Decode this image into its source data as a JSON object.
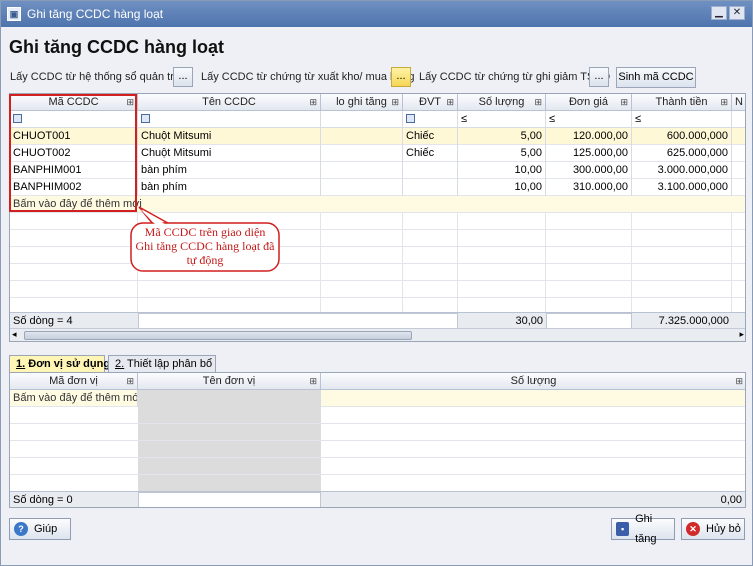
{
  "window": {
    "title": "Ghi tăng CCDC hàng loạt",
    "minimize": "▁",
    "close": "✕"
  },
  "heading": "Ghi tăng CCDC hàng loạt",
  "toolbar": {
    "label1": "Lấy CCDC từ hệ thống sổ quản trị",
    "label2": "Lấy CCDC từ chứng từ xuất kho/ mua hàng",
    "label3": "Lấy CCDC từ chứng từ ghi giảm TSCĐ",
    "dots": "...",
    "sinh_ma": "Sinh mã CCDC"
  },
  "main_grid": {
    "columns": [
      "Mã CCDC",
      "Tên CCDC",
      "lo ghi tăng",
      "ĐVT",
      "Số lượng",
      "Đơn giá",
      "Thành tiền",
      "N"
    ],
    "filter_ops": {
      "soluong": "≤",
      "dongia": "≤",
      "thanhtien": "≤"
    },
    "rows": [
      {
        "ma": "CHUOT001",
        "ten": "Chuột Mitsumi",
        "dvt": "Chiếc",
        "soluong": "5,00",
        "dongia": "120.000,00",
        "thanhtien": "600.000,000"
      },
      {
        "ma": "CHUOT002",
        "ten": "Chuột Mitsumi",
        "dvt": "Chiếc",
        "soluong": "5,00",
        "dongia": "125.000,00",
        "thanhtien": "625.000,000"
      },
      {
        "ma": "BANPHIM001",
        "ten": "bàn phím",
        "dvt": "",
        "soluong": "10,00",
        "dongia": "300.000,00",
        "thanhtien": "3.000.000,000"
      },
      {
        "ma": "BANPHIM002",
        "ten": "bàn phím",
        "dvt": "",
        "soluong": "10,00",
        "dongia": "310.000,00",
        "thanhtien": "3.100.000,000"
      }
    ],
    "new_row": "Bấm vào đây để thêm mới",
    "footer": {
      "count": "Số dòng = 4",
      "soluong_total": "30,00",
      "thanhtien_total": "7.325.000,000"
    }
  },
  "callout": {
    "text": "Mã CCDC trên giao diện Ghi tăng CCDC hàng loạt đã tự động",
    "color": "#d21f1f"
  },
  "tabs": [
    {
      "num": "1.",
      "label": "Đơn vị sử dụng"
    },
    {
      "num": "2.",
      "label": "Thiết lập phân bổ"
    }
  ],
  "sub_grid": {
    "columns": [
      "Mã đơn vị",
      "Tên đơn vị",
      "Số lượng"
    ],
    "new_row": "Bấm vào đây để thêm mới",
    "footer": {
      "count": "Số dòng = 0",
      "total": "0,00"
    }
  },
  "buttons": {
    "help": "Giúp",
    "save": "Ghi tăng",
    "cancel": "Hủy bỏ"
  }
}
